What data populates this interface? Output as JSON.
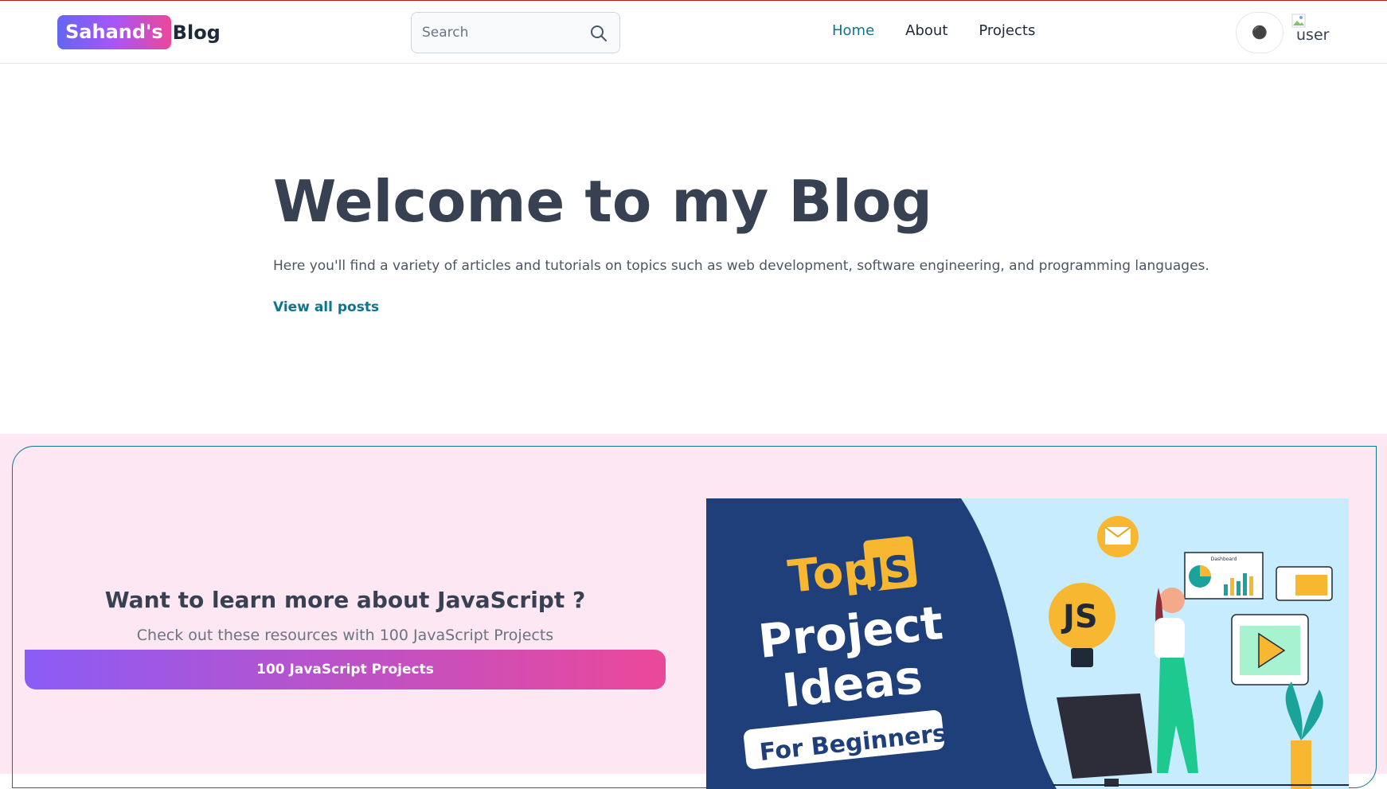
{
  "header": {
    "logo_badge": "Sahand's",
    "logo_text": "Blog",
    "search_placeholder": "Search",
    "nav": [
      {
        "label": "Home",
        "active": true
      },
      {
        "label": "About",
        "active": false
      },
      {
        "label": "Projects",
        "active": false
      }
    ],
    "theme_icon": "sun-icon",
    "avatar_alt": "user"
  },
  "hero": {
    "title": "Welcome to my Blog",
    "description": "Here you'll find a variety of articles and tutorials on topics such as web development, software engineering, and programming languages.",
    "link_label": "View all posts"
  },
  "cta": {
    "title": "Want to learn more about JavaScript ?",
    "subtitle": "Check out these resources with 100 JavaScript Projects",
    "button_label": "100 JavaScript Projects",
    "image": {
      "line1_a": "Top",
      "line1_b": "JS",
      "line2": "Project",
      "line3": "Ideas",
      "line4": "For Beginners",
      "dashboard_label": "Dashboard",
      "bulb_label": "JS"
    }
  },
  "colors": {
    "accent": "#0e7490",
    "brand_gradient_start": "#6366f1",
    "brand_gradient_end": "#ec4899",
    "cta_background": "#fce7f3"
  }
}
